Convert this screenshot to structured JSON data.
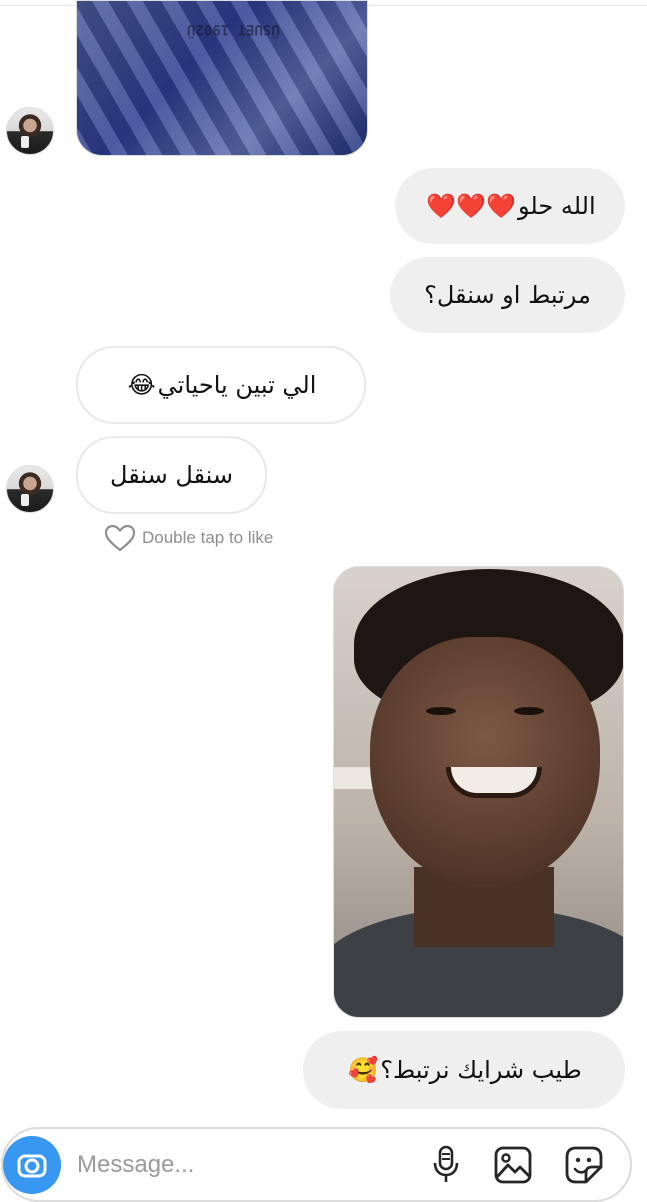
{
  "messages": {
    "m1": {
      "text": "الله حلو",
      "emoji": "❤️❤️❤️"
    },
    "m2": {
      "text": "مرتبط او سنقل؟"
    },
    "m3": {
      "text": "الي تبين ياحياتي",
      "emoji": "😂"
    },
    "m4": {
      "text": "سنقل سنقل"
    },
    "m5": {
      "text": "طيب شرايك نرتبط؟",
      "emoji": "🥰"
    }
  },
  "like_hint": "Double tap to like",
  "composer": {
    "placeholder": "Message..."
  },
  "photo_top_print": "ÜSUET 1902Ü",
  "colors": {
    "accent": "#3897f0",
    "outgoing_bubble": "#efefef",
    "incoming_border": "#e8e8e8"
  },
  "icons": [
    "camera-icon",
    "microphone-icon",
    "gallery-icon",
    "sticker-icon",
    "heart-outline-icon"
  ]
}
